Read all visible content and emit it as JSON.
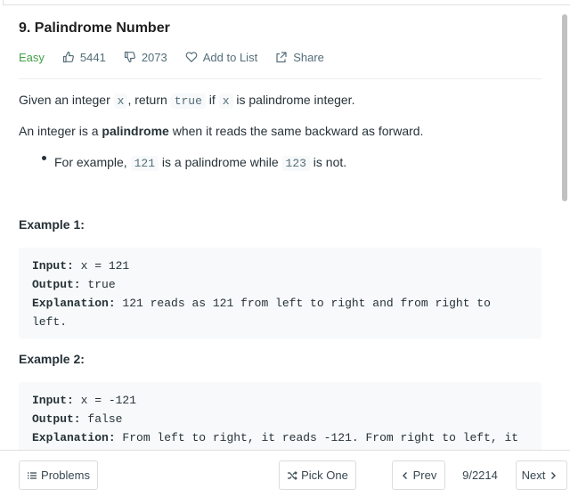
{
  "problem": {
    "title": "9. Palindrome Number",
    "difficulty": "Easy",
    "likes": "5441",
    "dislikes": "2073",
    "add_to_list": "Add to List",
    "share": "Share"
  },
  "description": {
    "line1_a": "Given an integer ",
    "line1_code1": "x",
    "line1_b": ", return ",
    "line1_code2": "true",
    "line1_c": " if ",
    "line1_code3": "x",
    "line1_d": " is palindrome integer.",
    "line2_a": "An integer is a ",
    "line2_bold": "palindrome",
    "line2_b": " when it reads the same backward as forward.",
    "bullet_a": "For example, ",
    "bullet_code1": "121",
    "bullet_b": " is a palindrome while ",
    "bullet_code2": "123",
    "bullet_c": " is not."
  },
  "examples": [
    {
      "title": "Example 1:",
      "input_label": "Input:",
      "input_value": " x = 121",
      "output_label": "Output:",
      "output_value": " true",
      "explanation_label": "Explanation:",
      "explanation_value": " 121 reads as 121 from left to right and from right to",
      "explanation_cont": "left."
    },
    {
      "title": "Example 2:",
      "input_label": "Input:",
      "input_value": " x = -121",
      "output_label": "Output:",
      "output_value": " false",
      "explanation_label": "Explanation:",
      "explanation_value": " From left to right, it reads -121. From right to left, it"
    }
  ],
  "footer": {
    "problems": "Problems",
    "pick_one": "Pick One",
    "prev": "Prev",
    "page": "9/2214",
    "next": "Next"
  },
  "colors": {
    "easy": "#43a047",
    "text": "#263238",
    "code_bg": "#f7f9fa"
  }
}
